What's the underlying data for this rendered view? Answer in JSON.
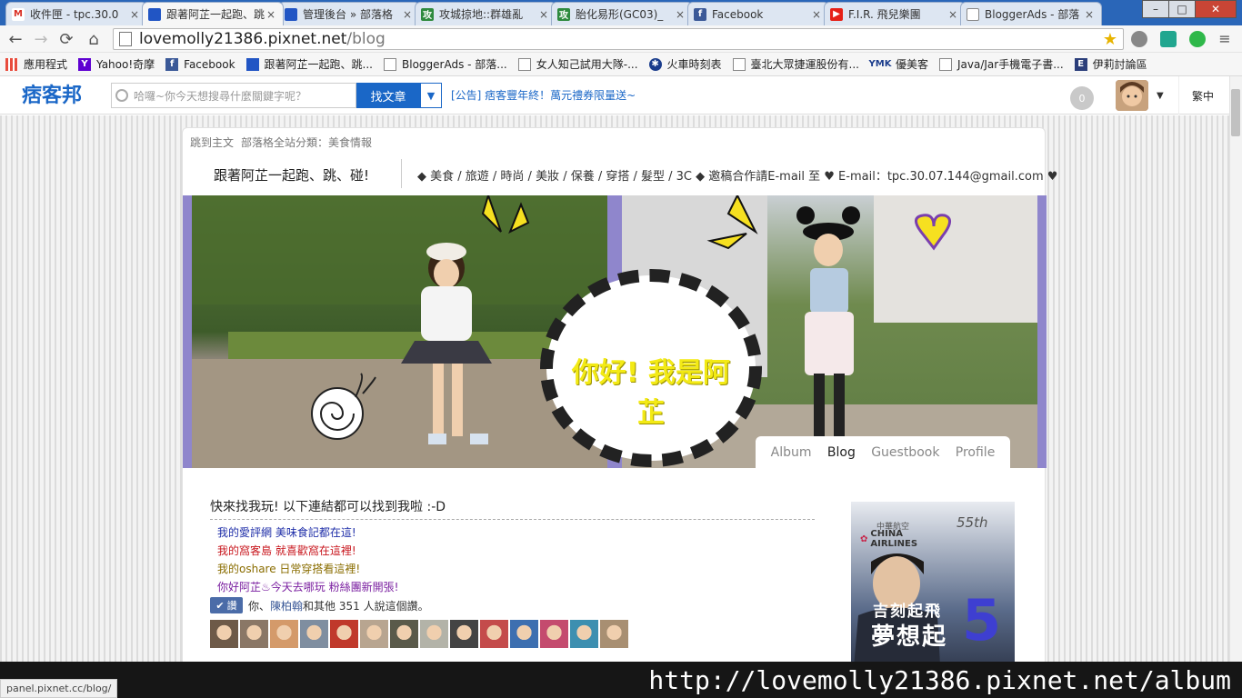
{
  "browser": {
    "tabs": [
      {
        "icon": "gmail-icon",
        "color": "#d93025",
        "glyph": "M",
        "title": "收件匣 - tpc.30.0"
      },
      {
        "icon": "pixnet-icon",
        "color": "#2155c4",
        "glyph": "",
        "title": "跟著阿芷一起跑、跳"
      },
      {
        "icon": "pixnet-icon",
        "color": "#2155c4",
        "glyph": "",
        "title": "管理後台 » 部落格"
      },
      {
        "icon": "game-icon",
        "color": "#2e8a3e",
        "glyph": "攻",
        "title": "攻城掠地::群雄亂"
      },
      {
        "icon": "game-icon",
        "color": "#2e8a3e",
        "glyph": "攻",
        "title": "胎化易形(GC03)_"
      },
      {
        "icon": "facebook-icon",
        "color": "#3b5998",
        "glyph": "f",
        "title": "Facebook"
      },
      {
        "icon": "youtube-icon",
        "color": "#e62117",
        "glyph": "▶",
        "title": "F.I.R. 飛兒樂團"
      },
      {
        "icon": "page-icon",
        "color": "#ffffff",
        "glyph": "",
        "title": "BloggerAds - 部落"
      }
    ],
    "active_tab": 1,
    "url_host": "lovemolly21386.pixnet.net",
    "url_path": "/blog",
    "bookmarks": [
      {
        "icon": "apps-icon",
        "color": "#e84c3d",
        "label": "應用程式"
      },
      {
        "icon": "yahoo-icon",
        "color": "#5f01d1",
        "label": "Yahoo!奇摩"
      },
      {
        "icon": "facebook-icon",
        "color": "#3b5998",
        "label": "Facebook"
      },
      {
        "icon": "pixnet-icon",
        "color": "#2155c4",
        "label": "跟著阿芷一起跑、跳..."
      },
      {
        "icon": "page-icon",
        "color": "#ffffff",
        "label": "BloggerAds - 部落..."
      },
      {
        "icon": "page-icon",
        "color": "#ffffff",
        "label": "女人知己試用大隊-..."
      },
      {
        "icon": "train-icon",
        "color": "#1a3c8c",
        "label": "火車時刻表"
      },
      {
        "icon": "page-icon",
        "color": "#ffffff",
        "label": "臺北大眾捷運股份有..."
      },
      {
        "icon": "ymk-icon",
        "color": "#1a3c8c",
        "label": "優美客"
      },
      {
        "icon": "page-icon",
        "color": "#ffffff",
        "label": "Java/Jar手機電子書..."
      },
      {
        "icon": "forum-icon",
        "color": "#2b3e7a",
        "label": "伊莉討論區"
      }
    ],
    "ymk_glyph": "YMK",
    "status_url": "panel.pixnet.cc/blog/"
  },
  "pixnet_header": {
    "logo": "痞客邦",
    "search_placeholder": "哈囉~你今天想搜尋什麼關鍵字呢？",
    "search_button": "找文章",
    "announcement": "[公告] 痞客豐年終！萬元禮券限量送~",
    "notification_count": "0",
    "language": "繁中"
  },
  "blog": {
    "skip_to_main": "跳到主文",
    "category": "部落格全站分類：美食情報",
    "title": "跟著阿芷一起跑、跳、碰!",
    "tagline": "◆ 美食 / 旅遊 / 時尚 / 美妝 / 保養 / 穿搭 / 髮型 / 3C ◆ 邀稿合作請E-mail 至 ♥ E-mail：tpc.30.07.144@gmail.com ♥",
    "banner_text": "你好! 我是阿芷",
    "nav_tabs": [
      "Album",
      "Blog",
      "Guestbook",
      "Profile"
    ],
    "active_nav": "Blog",
    "post_heading": "快來找我玩! 以下連結都可以找到我啦 :-D",
    "links": [
      {
        "text": "我的愛評網 美味食記都在這!",
        "color": "#1f2ea8"
      },
      {
        "text": "我的窩客島 就喜歡窩在這裡!",
        "color": "#c8161d"
      },
      {
        "text": "我的oshare 日常穿搭看這裡!",
        "color": "#8a6d00"
      },
      {
        "text": "你好阿芷♨今天去哪玩 粉絲團新開張!",
        "color": "#7a1fa0"
      }
    ],
    "like_button": "讚",
    "like_text_pre": "你、",
    "like_friend": "陳柏翰",
    "like_text_post": "和其他 351 人說這個讚。",
    "face_colors": [
      "#6e5a48",
      "#8a7766",
      "#d49a6a",
      "#7f8ea0",
      "#c0392b",
      "#b8a590",
      "#5a5a4a",
      "#b3b3a8",
      "#444",
      "#c44b4b",
      "#3d6fb0",
      "#c44b6e",
      "#3d8fb0",
      "#a88f72"
    ],
    "ad": {
      "airline_cn": "中華航空",
      "airline_en": "CHINA AIRLINES",
      "anniv": "55th",
      "line1": "吉刻起飛",
      "line2": "夢想起",
      "num": "5"
    }
  },
  "overlay_url": "http://lovemolly21386.pixnet.net/album"
}
